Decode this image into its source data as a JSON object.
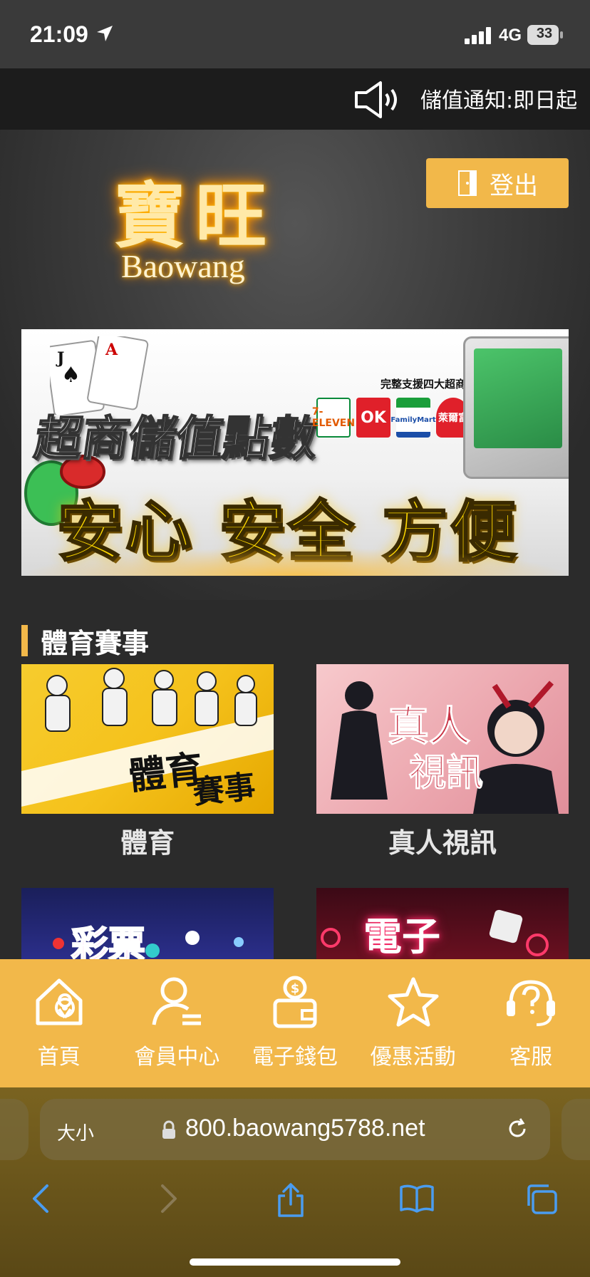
{
  "status": {
    "time": "21:09",
    "network": "4G",
    "battery": "33"
  },
  "notice": {
    "text": "儲值通知:即日起"
  },
  "header": {
    "logo_cn": "寶旺",
    "logo_en": "Baowang",
    "logout_label": "登出"
  },
  "banner": {
    "title": "超商儲值點數",
    "slogan": "安心 安全 方便",
    "support": "完整支援四大超商",
    "stores": [
      "7-ELEVEN",
      "OK",
      "FamilyMart",
      "萊爾富"
    ]
  },
  "section": {
    "title": "體育賽事"
  },
  "tiles": [
    {
      "caption": "體育",
      "art_text_1": "體育",
      "art_text_2": "賽事"
    },
    {
      "caption": "真人視訊",
      "art_text_1": "真人",
      "art_text_2": "視訊"
    },
    {
      "art_text_1": "彩票"
    },
    {
      "art_text_1": "電子"
    }
  ],
  "bottom_nav": [
    {
      "label": "首頁",
      "icon": "home-location-icon"
    },
    {
      "label": "會員中心",
      "icon": "member-icon"
    },
    {
      "label": "電子錢包",
      "icon": "wallet-icon"
    },
    {
      "label": "優惠活動",
      "icon": "star-icon"
    },
    {
      "label": "客服",
      "icon": "support-icon"
    }
  ],
  "browser": {
    "size_label": "大小",
    "url": "800.baowang5788.net"
  },
  "colors": {
    "accent": "#f2b84a",
    "background": "#2b2b2b"
  }
}
